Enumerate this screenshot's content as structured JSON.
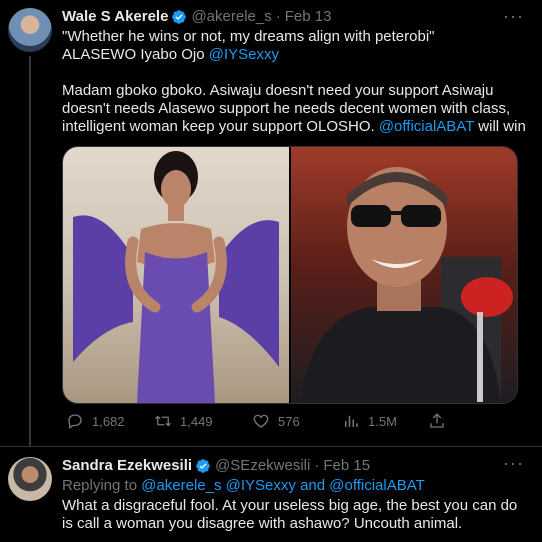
{
  "tweet1": {
    "name": "Wale S Akerele",
    "handle": "@akerele_s",
    "date": "Feb 13",
    "more": "···",
    "quote_line": "\"Whether he wins or not, my dreams align with peterobi\"",
    "line2_prefix": "ALASEWO  Iyabo Ojo ",
    "line2_mention": "@IYSexxy",
    "body_text": "Madam gboko gboko. Asiwaju doesn't need your support Asiwaju doesn't needs Alasewo support he needs decent women with class, intelligent woman keep your support OLOSHO.  ",
    "body_mention": "@officialABAT",
    "body_suffix": " will win",
    "actions": {
      "reply_count": "1,682",
      "retweet_count": "1,449",
      "like_count": "576",
      "views_count": "1.5M"
    }
  },
  "tweet2": {
    "name": "Sandra Ezekwesili",
    "handle": "@SEzekwesili",
    "date": "Feb 15",
    "more": "···",
    "replying_prefix": "Replying to ",
    "replying_to": "@akerele_s @IYSexxy and @officialABAT",
    "body": "What a disgraceful fool. At your useless big age, the best you can do is call a woman you disagree with ashawo? Uncouth animal."
  },
  "icons": {
    "verified": "verified-badge-icon",
    "reply": "reply-icon",
    "retweet": "retweet-icon",
    "like": "heart-icon",
    "views": "views-chart-icon",
    "share": "share-icon",
    "more": "more-dots-icon"
  },
  "colors": {
    "background": "#000000",
    "text": "#e7e9ea",
    "secondary_text": "#71767b",
    "accent": "#1d9bf0",
    "border": "#2f3336"
  }
}
